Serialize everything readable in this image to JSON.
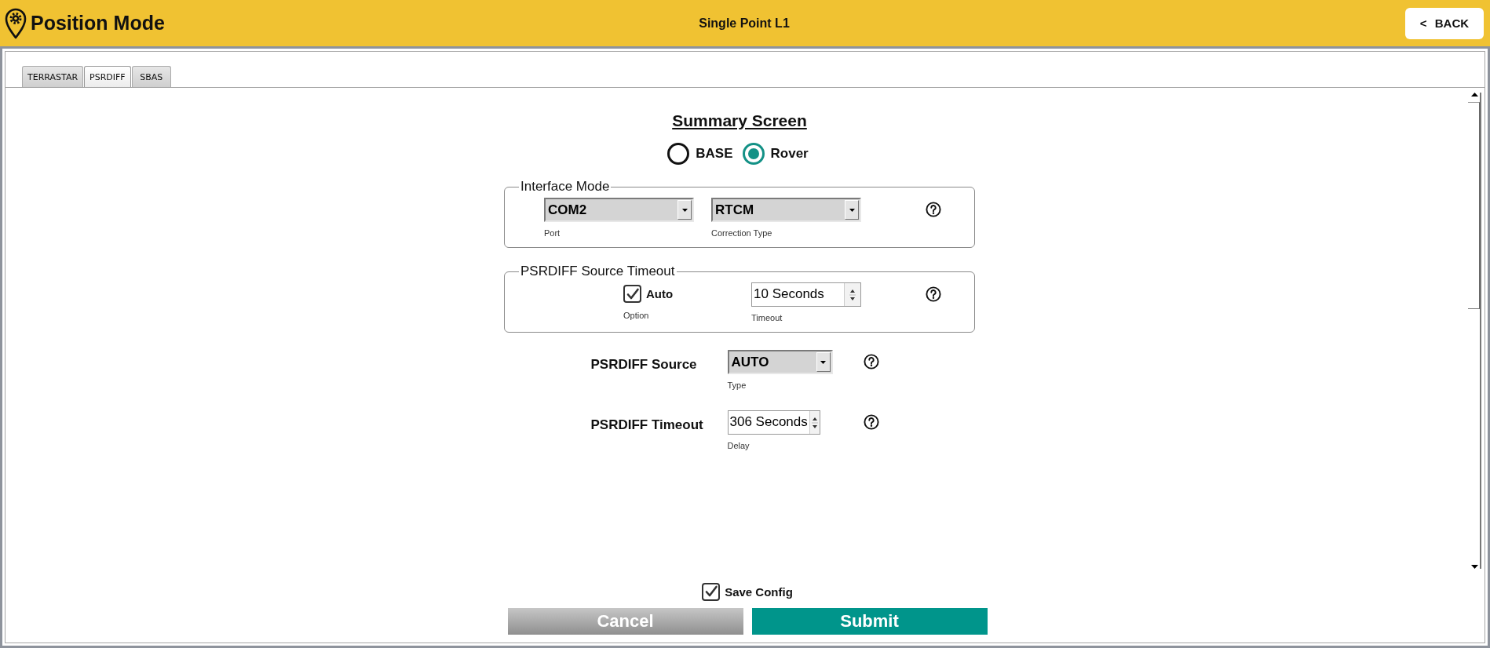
{
  "header": {
    "title": "Position Mode",
    "subtitle": "Single Point L1",
    "back_button": "< BACK"
  },
  "tabs": [
    {
      "label": "TERRASTAR",
      "selected": false
    },
    {
      "label": "PSRDIFF",
      "selected": true
    },
    {
      "label": "SBAS",
      "selected": false
    }
  ],
  "summary": {
    "title": "Summary Screen",
    "modes": [
      {
        "label": "BASE",
        "selected": false
      },
      {
        "label": "Rover",
        "selected": true
      }
    ]
  },
  "interface_mode": {
    "legend": "Interface Mode",
    "fields": [
      {
        "kind": "select",
        "value": "COM2",
        "caption": "Port"
      },
      {
        "kind": "select",
        "value": "RTCM",
        "caption": "Correction Type"
      }
    ]
  },
  "source_timeout": {
    "legend": "PSRDIFF Source Timeout",
    "fields": [
      {
        "kind": "checkbox",
        "label": "Auto",
        "checked": true,
        "caption": "Option"
      },
      {
        "kind": "spinner",
        "value": "10 Seconds",
        "caption": "Timeout"
      }
    ]
  },
  "settings": [
    {
      "label": "PSRDIFF Source",
      "field": {
        "kind": "select",
        "value": "AUTO",
        "caption": "Type"
      }
    },
    {
      "label": "PSRDIFF Timeout",
      "field": {
        "kind": "spinner",
        "value": "306 Seconds",
        "caption": "Delay"
      }
    }
  ],
  "save_config": {
    "label": "Save Config",
    "checked": true
  },
  "buttons": [
    {
      "label": "Cancel",
      "kind": "secondary"
    },
    {
      "label": "Submit",
      "kind": "primary"
    }
  ]
}
